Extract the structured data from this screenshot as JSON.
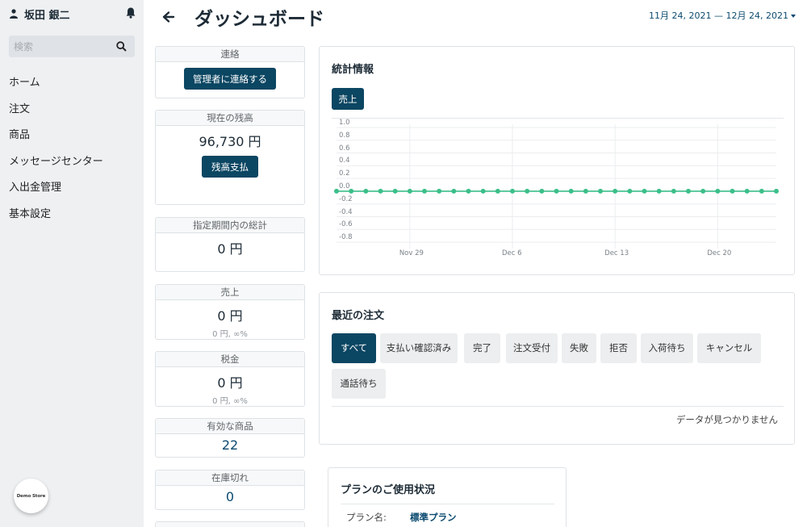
{
  "sidebar": {
    "user_name": "坂田 銀二",
    "search_placeholder": "検索",
    "nav": [
      {
        "label": "ホーム"
      },
      {
        "label": "注文"
      },
      {
        "label": "商品"
      },
      {
        "label": "メッセージセンター"
      },
      {
        "label": "入出金管理"
      },
      {
        "label": "基本設定"
      }
    ],
    "logo_text": "Demo Store"
  },
  "header": {
    "title": "ダッシュボード",
    "date_range": "11月 24, 2021 — 12月 24, 2021"
  },
  "cards": {
    "contact": {
      "title": "連絡",
      "button": "管理者に連絡する"
    },
    "balance": {
      "title": "現在の残高",
      "value": "96,730 円",
      "button": "残高支払"
    },
    "period_total": {
      "title": "指定期間内の総計",
      "value": "0 円"
    },
    "sales": {
      "title": "売上",
      "value": "0 円",
      "sub": "0 円, ∞%"
    },
    "tax": {
      "title": "税金",
      "value": "0 円",
      "sub": "0 円, ∞%"
    },
    "active_products": {
      "title": "有効な商品",
      "value": "22"
    },
    "out_of_stock": {
      "title": "在庫切れ",
      "value": "0"
    }
  },
  "stats": {
    "title": "統計情報",
    "tab": "売上",
    "line_color": "#3cbf8a"
  },
  "chart_data": {
    "type": "line",
    "series": [
      {
        "name": "売上",
        "values": [
          0,
          0,
          0,
          0,
          0,
          0,
          0,
          0,
          0,
          0,
          0,
          0,
          0,
          0,
          0,
          0,
          0,
          0,
          0,
          0,
          0,
          0,
          0,
          0,
          0,
          0,
          0,
          0,
          0,
          0,
          0
        ]
      }
    ],
    "x": [
      "Nov 24",
      "Nov 25",
      "Nov 26",
      "Nov 27",
      "Nov 28",
      "Nov 29",
      "Nov 30",
      "Dec 1",
      "Dec 2",
      "Dec 3",
      "Dec 4",
      "Dec 5",
      "Dec 6",
      "Dec 7",
      "Dec 8",
      "Dec 9",
      "Dec 10",
      "Dec 11",
      "Dec 12",
      "Dec 13",
      "Dec 14",
      "Dec 15",
      "Dec 16",
      "Dec 17",
      "Dec 18",
      "Dec 19",
      "Dec 20",
      "Dec 21",
      "Dec 22",
      "Dec 23",
      "Dec 24"
    ],
    "x_ticks": [
      "Nov 29",
      "Dec 6",
      "Dec 13",
      "Dec 20"
    ],
    "y_ticks": [
      "1.0",
      "0.8",
      "0.6",
      "0.4",
      "0.2",
      "0.0",
      "-0.2",
      "-0.4",
      "-0.6",
      "-0.8"
    ],
    "ylim": [
      -0.9,
      1.05
    ],
    "grid": true
  },
  "orders": {
    "title": "最近の注文",
    "filters": [
      {
        "label": "すべて"
      },
      {
        "label": "支払い確認済み"
      },
      {
        "label": "完了"
      },
      {
        "label": "注文受付"
      },
      {
        "label": "失敗"
      },
      {
        "label": "拒否"
      },
      {
        "label": "入荷待ち"
      },
      {
        "label": "キャンセル"
      },
      {
        "label": "通話待ち"
      }
    ],
    "empty_text": "データが見つかりません"
  },
  "plan": {
    "title": "プランのご使用状況",
    "name_label": "プラン名:",
    "name_value": "標準プラン"
  }
}
